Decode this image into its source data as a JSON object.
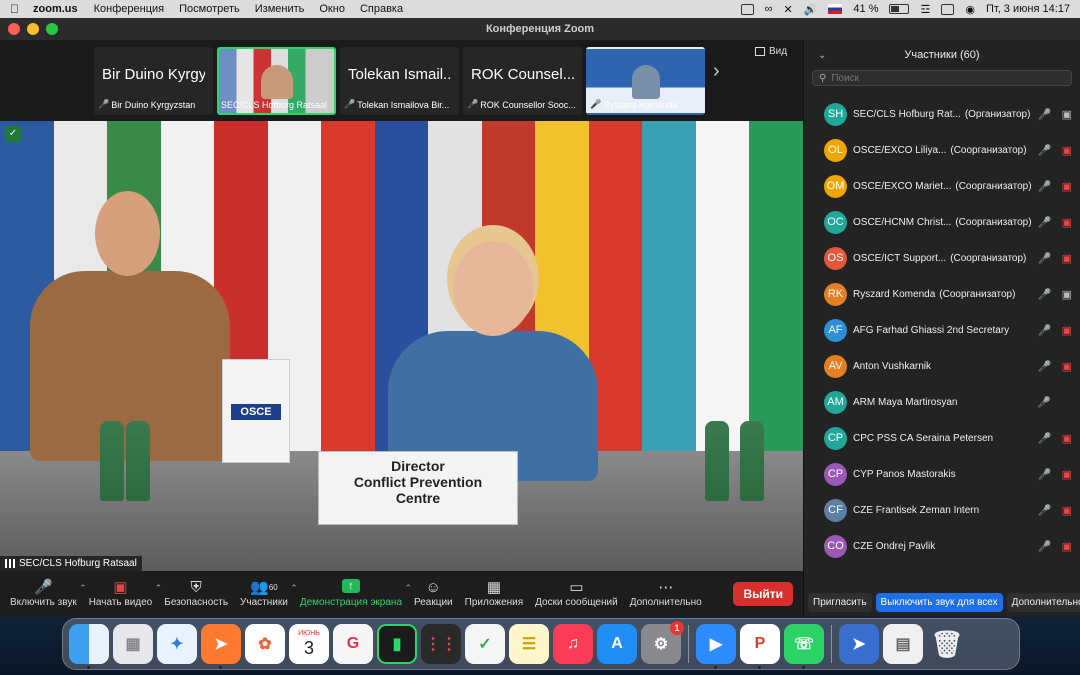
{
  "menubar": {
    "app": "zoom.us",
    "items": [
      "Конференция",
      "Посмотреть",
      "Изменить",
      "Окно",
      "Справка"
    ],
    "battery": "41 %",
    "datetime": "Пт, 3 июня  14:17"
  },
  "window": {
    "title": "Конференция Zoom"
  },
  "thumbnails": [
    {
      "big": "Bir Duino Kyrgyz...",
      "label": "Bir Duino Kyrgyzstan",
      "muted": true
    },
    {
      "big": "",
      "label": "SEC/CLS Hofburg Ratsaal",
      "muted": false,
      "active": true
    },
    {
      "big": "Tolekan Ismail...",
      "label": "Tolekan Ismailova Bir...",
      "muted": true
    },
    {
      "big": "ROK Counsel...",
      "label": "ROK Counsellor Sooc...",
      "muted": true
    },
    {
      "big": "",
      "label": "Ryszard Komenda",
      "muted": true
    }
  ],
  "view_label": "Вид",
  "main_video": {
    "nameplate": [
      "Director",
      "Conflict Prevention",
      "Centre"
    ],
    "banner_logo": "OSCE",
    "speaker": "SEC/CLS Hofburg Ratsaal"
  },
  "toolbar": {
    "audio": "Включить звук",
    "video": "Начать видео",
    "security": "Безопасность",
    "participants": "Участники",
    "participants_count": "60",
    "share": "Демонстрация экрана",
    "reactions": "Реакции",
    "apps": "Приложения",
    "whiteboards": "Доски сообщений",
    "more": "Дополнительно",
    "leave": "Выйти"
  },
  "panel": {
    "title": "Участники (60)",
    "search_placeholder": "Поиск",
    "participants": [
      {
        "initials": "SH",
        "name": "SEC/CLS Hofburg Rat...",
        "role": "(Организатор)",
        "color": "#1fa89a",
        "mic": "on",
        "cam": "on"
      },
      {
        "initials": "OL",
        "name": "OSCE/EXCO Liliya...",
        "role": "(Соорганизатор)",
        "color": "#f0a500",
        "mic": "off",
        "cam": "off"
      },
      {
        "initials": "OM",
        "name": "OSCE/EXCO Mariet...",
        "role": "(Соорганизатор)",
        "color": "#f0a500",
        "mic": "off",
        "cam": "off"
      },
      {
        "initials": "OC",
        "name": "OSCE/HCNM Christ...",
        "role": "(Соорганизатор)",
        "color": "#1fa89a",
        "mic": "off",
        "cam": "off"
      },
      {
        "initials": "OS",
        "name": "OSCE/ICT Support...",
        "role": "(Соорганизатор)",
        "color": "#e4573a",
        "mic": "off",
        "cam": "off"
      },
      {
        "initials": "RK",
        "name": "Ryszard Komenda",
        "role": "(Соорганизатор)",
        "color": "#e67e22",
        "mic": "off",
        "cam": "on"
      },
      {
        "initials": "AF",
        "name": "AFG Farhad Ghiassi 2nd Secretary",
        "role": "",
        "color": "#2d8fd6",
        "mic": "off",
        "cam": "off"
      },
      {
        "initials": "AV",
        "name": "Anton Vushkarnik",
        "role": "",
        "color": "#e67e22",
        "mic": "off",
        "cam": "off"
      },
      {
        "initials": "AM",
        "name": "ARM Maya Martirosyan",
        "role": "",
        "color": "#1fa89a",
        "mic": "off",
        "cam": ""
      },
      {
        "initials": "CP",
        "name": "CPC PSS CA Seraina Petersen",
        "role": "",
        "color": "#1fa89a",
        "mic": "off",
        "cam": "off"
      },
      {
        "initials": "CP",
        "name": "CYP Panos Mastorakis",
        "role": "",
        "color": "#9b59b6",
        "mic": "off",
        "cam": "off"
      },
      {
        "initials": "CF",
        "name": "CZE Frantisek Zeman Intern",
        "role": "",
        "color": "#5d7fa3",
        "mic": "off",
        "cam": "off"
      },
      {
        "initials": "CO",
        "name": "CZE Ondrej Pavlik",
        "role": "",
        "color": "#9b59b6",
        "mic": "off",
        "cam": "off"
      }
    ],
    "invite": "Пригласить",
    "mute_all": "Выключить звук для всех",
    "more": "Дополнительно"
  },
  "dock": {
    "calendar_month": "ИЮНЬ",
    "calendar_day": "3",
    "settings_badge": "1"
  }
}
